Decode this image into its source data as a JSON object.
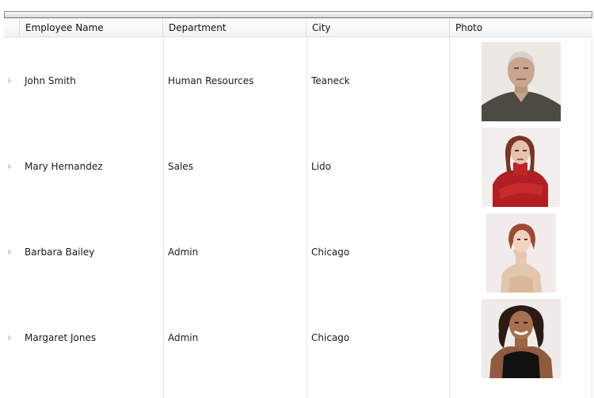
{
  "columns": {
    "name": "Employee Name",
    "department": "Department",
    "city": "City",
    "photo": "Photo"
  },
  "rows": [
    {
      "name": "John Smith",
      "department": "Human Resources",
      "city": "Teaneck",
      "photo_icon": "employee-photo-john-smith"
    },
    {
      "name": "Mary Hernandez",
      "department": "Sales",
      "city": "Lido",
      "photo_icon": "employee-photo-mary-hernandez"
    },
    {
      "name": "Barbara Bailey",
      "department": "Admin",
      "city": "Chicago",
      "photo_icon": "employee-photo-barbara-bailey"
    },
    {
      "name": "Margaret Jones",
      "department": "Admin",
      "city": "Chicago",
      "photo_icon": "employee-photo-margaret-jones"
    }
  ]
}
